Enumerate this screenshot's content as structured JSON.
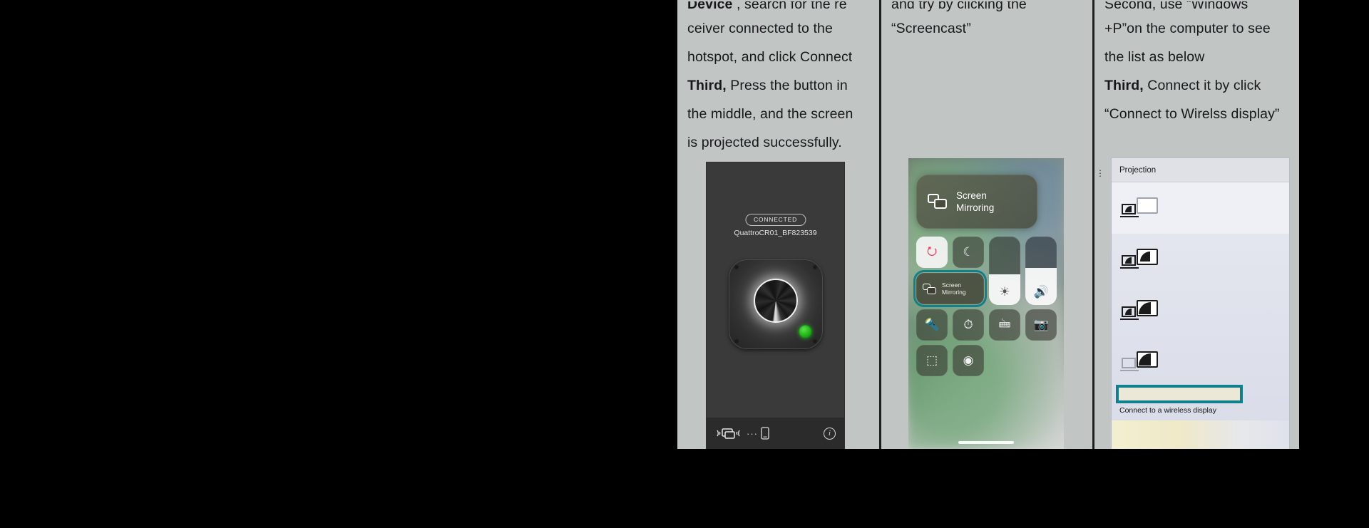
{
  "document": {
    "background_color": "#000000",
    "sheet_color": "#c1c5c4",
    "accent_teal": "#12808c"
  },
  "columns": [
    {
      "id": "column-1",
      "lines": [
        {
          "text": "Device , search for the re",
          "clipped": true,
          "bold_prefix": "Device"
        },
        {
          "text": "ceiver connected to the"
        },
        {
          "text": "hotspot, and click Connect"
        },
        {
          "text": "Third, Press the button in",
          "bold_prefix": "Third,"
        },
        {
          "text": "the middle, and the screen"
        },
        {
          "text": "is projected successfully."
        }
      ],
      "device_screenshot": {
        "status_badge": "CONNECTED",
        "device_name": "QuattroCR01_BF823539",
        "footer_icons": [
          "cast-icon",
          "ellipsis-icon",
          "phone-icon",
          "info-icon"
        ],
        "led_color": "#1fb017"
      }
    },
    {
      "id": "column-2",
      "lines": [
        {
          "text": "and try by clicking the",
          "clipped": true
        },
        {
          "text": "“Screencast”"
        }
      ],
      "control_center": {
        "popup": {
          "label_line1": "Screen",
          "label_line2": "Mirroring",
          "icon": "screen-mirroring-icon"
        },
        "tiles": [
          {
            "name": "rotation-lock-tile",
            "glyph": "⭮",
            "style": "light"
          },
          {
            "name": "do-not-disturb-tile",
            "glyph": "☾",
            "style": "dark"
          },
          {
            "name": "brightness-slider",
            "glyph": "☀",
            "style": "slider"
          },
          {
            "name": "volume-slider",
            "glyph": "🔊",
            "style": "slider-vol"
          },
          {
            "name": "screen-mirroring-tile",
            "label_line1": "Screen",
            "label_line2": "Mirroring",
            "style": "wide-highlighted"
          },
          {
            "name": "flashlight-tile",
            "glyph": "🔦",
            "style": "dark"
          },
          {
            "name": "timer-tile",
            "glyph": "⏱",
            "style": "dark"
          },
          {
            "name": "calculator-tile",
            "glyph": "🖮",
            "style": "dark"
          },
          {
            "name": "camera-tile",
            "glyph": "📷",
            "style": "dark"
          },
          {
            "name": "qr-scanner-tile",
            "glyph": "⬚",
            "style": "dark"
          },
          {
            "name": "screen-record-tile",
            "glyph": "◉",
            "style": "dark"
          }
        ]
      }
    },
    {
      "id": "column-3",
      "lines": [
        {
          "text": "Second, use “Windows",
          "clipped": true
        },
        {
          "text": "+P”on the computer to see"
        },
        {
          "text": "the list as below"
        },
        {
          "text": "Third, Connect it by click",
          "bold_prefix": "Third,"
        },
        {
          "text": "“Connect to Wirelss display”"
        }
      ],
      "projection_flyout": {
        "title": "Projection",
        "options": [
          {
            "name": "pc-screen-only",
            "icon": "laptop-monitor-off-icon",
            "selected": true
          },
          {
            "name": "duplicate",
            "icon": "laptop-monitor-duplicate-icon",
            "selected": false
          },
          {
            "name": "extend",
            "icon": "laptop-monitor-extend-icon",
            "selected": false
          },
          {
            "name": "second-screen-only",
            "icon": "laptop-off-monitor-on-icon",
            "selected": false
          }
        ],
        "link_label": "Connect to a wireless display",
        "highlight_color": "#12808c"
      }
    }
  ]
}
